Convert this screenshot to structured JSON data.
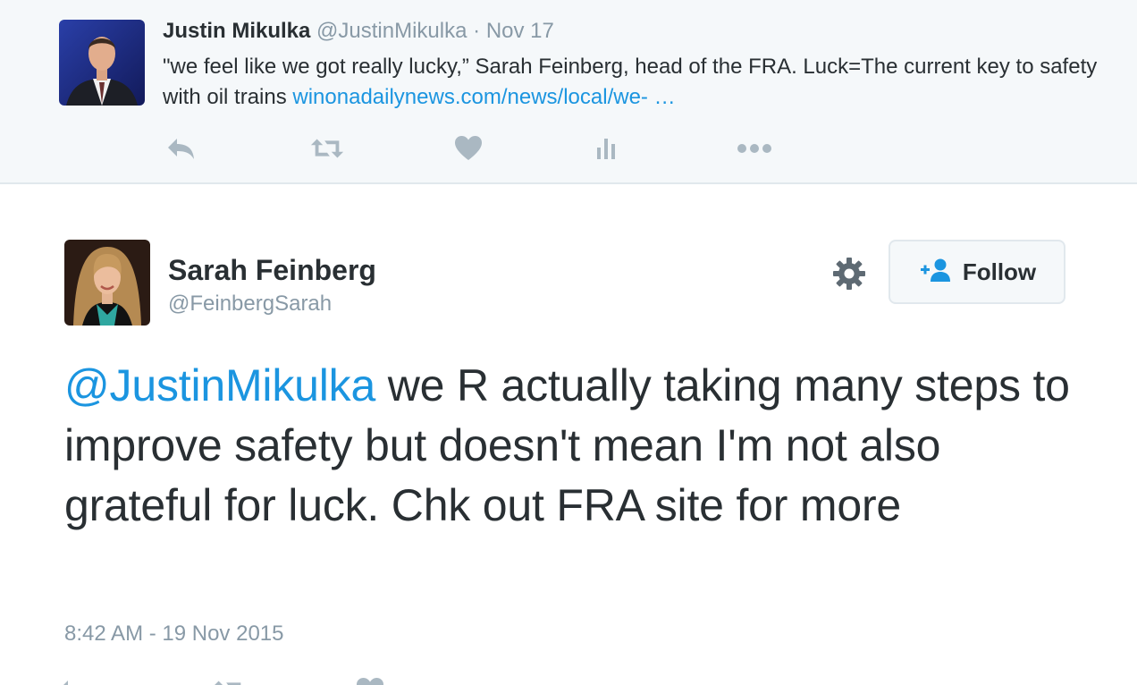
{
  "parent_tweet": {
    "author_name": "Justin Mikulka",
    "author_handle": "@JustinMikulka",
    "separator": "·",
    "date": "Nov 17",
    "text_before_link": "\"we feel like we got really lucky,” Sarah Feinberg, head of the FRA. Luck=The current key to safety with oil trains ",
    "link": "winonadailynews.com/news/local/we-",
    "ellipsis": " …",
    "actions": [
      {
        "icon": "reply-icon"
      },
      {
        "icon": "retweet-icon"
      },
      {
        "icon": "heart-icon"
      },
      {
        "icon": "analytics-icon"
      },
      {
        "icon": "more-icon"
      }
    ]
  },
  "main_tweet": {
    "author_name": "Sarah Feinberg",
    "author_handle": "@FeinbergSarah",
    "follow_label": "Follow",
    "mention": "@JustinMikulka",
    "text": " we R actually taking many steps to improve safety but doesn't mean I'm not also grateful for luck. Chk out FRA site for more",
    "timestamp": "8:42 AM - 19 Nov 2015"
  },
  "colors": {
    "link": "#1b95e0",
    "muted": "#8899a6",
    "text": "#292f33",
    "parent_bg": "#f5f8fa",
    "border": "#e1e8ed",
    "icon": "#aab8c2"
  }
}
